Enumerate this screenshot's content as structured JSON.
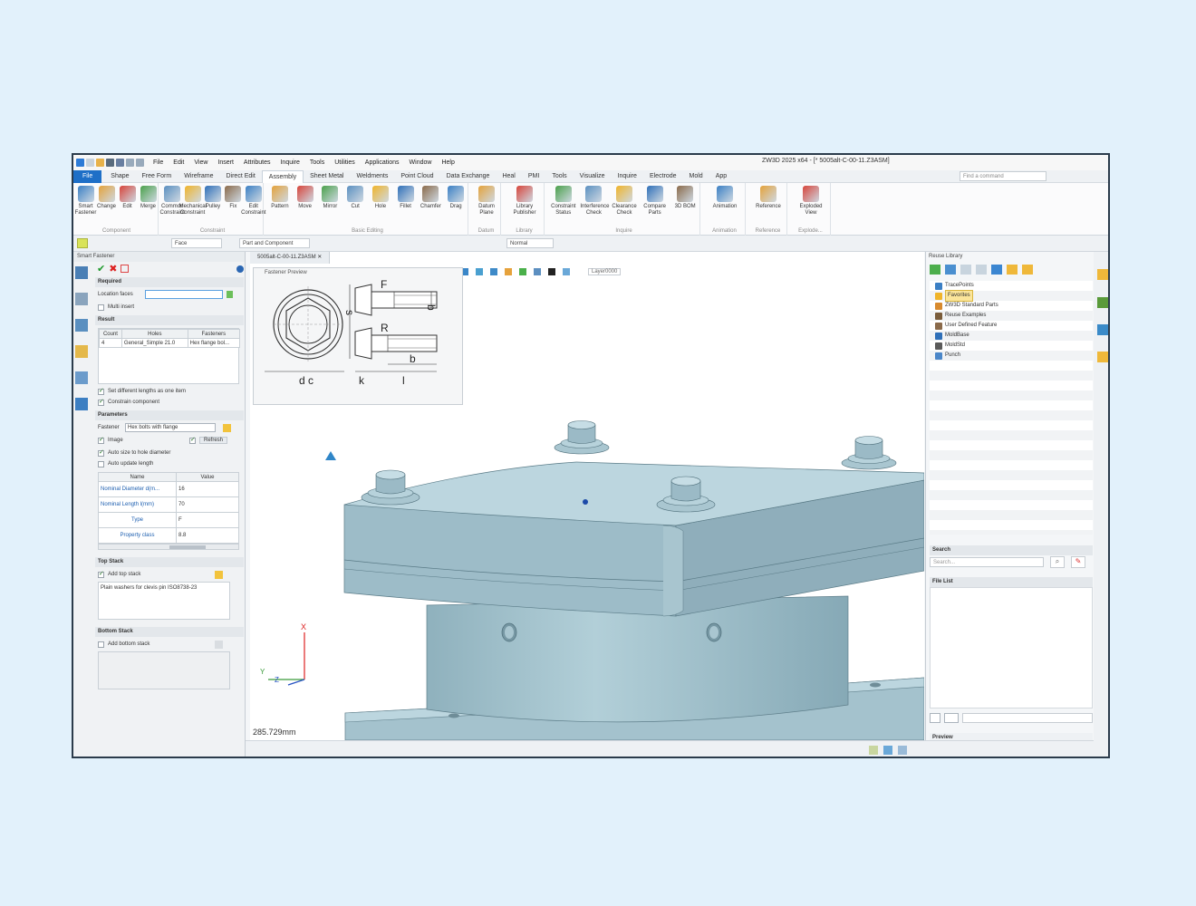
{
  "window_title": "ZW3D 2025 x64 - [* 5005alt-C-00-11.Z3ASM]",
  "menu_items": [
    "File",
    "Edit",
    "View",
    "Insert",
    "Attributes",
    "Inquire",
    "Tools",
    "Utilities",
    "Applications",
    "Window",
    "Help"
  ],
  "tabs": [
    "File",
    "Shape",
    "Free Form",
    "Wireframe",
    "Direct Edit",
    "Assembly",
    "Sheet Metal",
    "Weldments",
    "Point Cloud",
    "Data Exchange",
    "Heal",
    "PMI",
    "Tools",
    "Visualize",
    "Inquire",
    "Electrode",
    "Mold",
    "App"
  ],
  "find_command_placeholder": "Find a command",
  "ribbon": {
    "groups": [
      {
        "label": "Component",
        "items": [
          "Smart Fastener",
          "Change",
          "Edit",
          "Merge"
        ]
      },
      {
        "label": "Constraint",
        "items": [
          "Common Constraint",
          "Mechanical Constraint",
          "Pulley",
          "Fix",
          "Edit Constraint"
        ]
      },
      {
        "label": "Basic Editing",
        "items": [
          "Pattern",
          "Move",
          "Mirror",
          "Cut",
          "Hole",
          "Fillet",
          "Chamfer",
          "Drag"
        ]
      },
      {
        "label": "Datum",
        "items": [
          "Datum Plane"
        ]
      },
      {
        "label": "Library",
        "items": [
          "Library Publisher"
        ]
      },
      {
        "label": "Inquire",
        "items": [
          "Constraint Status",
          "Interference Check",
          "Clearance Check",
          "Compare Parts",
          "3D BOM"
        ]
      },
      {
        "label": "Animation",
        "items": [
          "Animation"
        ]
      },
      {
        "label": "Reference",
        "items": [
          "Reference"
        ]
      },
      {
        "label": "Explode...",
        "items": [
          "Exploded View"
        ]
      }
    ]
  },
  "cmdbar": {
    "filter": "Face",
    "scope": "Part and Component",
    "render": "Normal"
  },
  "left_panel": {
    "title": "Smart Fastener",
    "required": "Required",
    "location_faces": "Location faces",
    "multi_insert": "Multi insert",
    "result": "Result",
    "result_headers": [
      "Count",
      "Holes",
      "Fasteners"
    ],
    "result_rows": [
      [
        "4",
        "General_Simple 21.0",
        "Hex flange bol..."
      ]
    ],
    "set_diff_lengths": "Set different lengths as one item",
    "constrain_component": "Constrain component",
    "parameters": "Parameters",
    "fastener_label": "Fastener",
    "fastener_value": "Hex bolts with flange",
    "image": "Image",
    "refresh": "Refresh",
    "auto_size": "Auto size to hole diameter",
    "auto_update": "Auto update length",
    "param_headers": [
      "Name",
      "Value"
    ],
    "params": [
      [
        "Nominal Diameter d(m...",
        "16"
      ],
      [
        "Nominal Length l(mm)",
        "70"
      ],
      [
        "Type",
        "F"
      ],
      [
        "Property class",
        "8.8"
      ]
    ],
    "top_stack": "Top Stack",
    "add_top_stack": "Add top stack",
    "top_stack_item": "Plain washers for clevis pin ISO8738-23",
    "bottom_stack": "Bottom Stack",
    "add_bottom_stack": "Add bottom stack"
  },
  "viewport": {
    "file_tab": "5005alt-C-00-11.Z3ASM",
    "preview_title": "Fastener Preview",
    "dims": {
      "F": "F",
      "R": "R",
      "s": "s",
      "b_top": "b",
      "b": "b",
      "dc": "d c",
      "k": "k",
      "l": "l"
    },
    "axis_x": "X",
    "axis_y": "Y",
    "axis_z": "Z",
    "layer": "Layer0000",
    "distance": "285.729mm"
  },
  "right_panel": {
    "title": "Reuse Library",
    "tree": [
      "TracePoints",
      "Favorites",
      "ZW3D Standard Parts",
      "Reuse Examples",
      "User Defined Feature",
      "MoldBase",
      "MoldStd",
      "Punch"
    ],
    "search": "Search",
    "search_placeholder": "Search...",
    "file_list": "File List",
    "preview": "Preview"
  },
  "colors": {
    "accent": "#1e6fc7",
    "model": "#9fbfcb",
    "model_dark": "#7fa3b0",
    "model_light": "#bcd6df"
  }
}
